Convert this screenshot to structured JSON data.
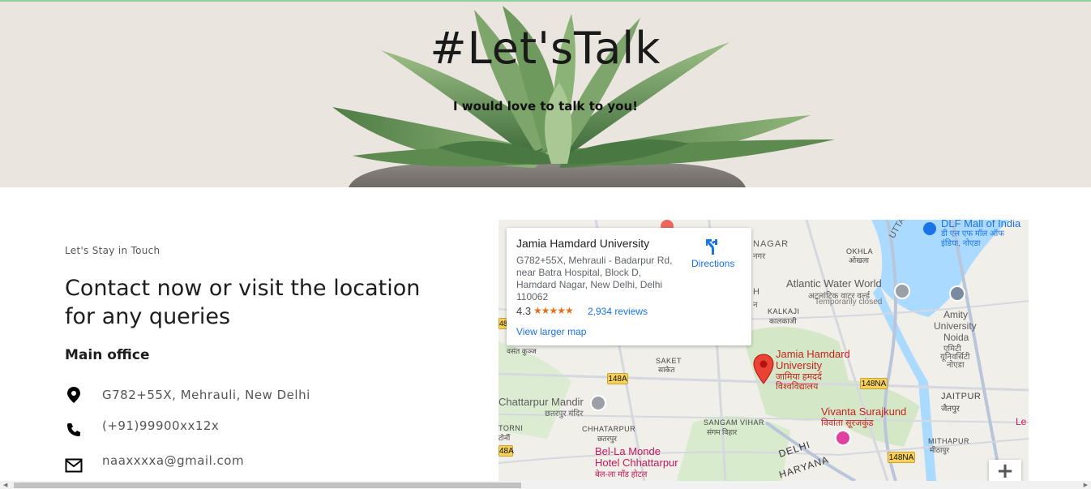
{
  "hero": {
    "title": "#Let'sTalk",
    "subtitle": "I would love to talk to you!"
  },
  "contact": {
    "eyebrow": "Let's Stay in Touch",
    "heading": "Contact now or visit the location for any queries",
    "office_label": "Main office",
    "address": "G782+55X, Mehrauli, New Delhi",
    "phone": "(+91)99900xx12x",
    "email": "naaxxxxa@gmail.com",
    "icons": [
      "location-pin-icon",
      "phone-icon",
      "mail-icon"
    ]
  },
  "map": {
    "card": {
      "name": "Jamia Hamdard University",
      "address": "G782+55X, Mehrauli - Badarpur Rd, near Batra Hospital, Block D, Hamdard Nagar, New Delhi, Delhi 110062",
      "rating": "4.3",
      "stars": "★★★★★",
      "reviews": "2,934 reviews",
      "view_larger": "View larger map",
      "directions": "Directions"
    },
    "labels": {
      "nagar": "NAGAR",
      "nagar_hi": "नगर",
      "okhla": "OKHLA",
      "okhla_hi": "ओखला",
      "dlf": "DLF Mall of India",
      "dlf_hi_1": "डी एल एफ मॉल ऑफ",
      "dlf_hi_2": "इंडिया, नोएडा",
      "atlantic": "Atlantic Water World",
      "atlantic_hi": "अटलांटिक वाटर वर्ल्ड",
      "atlantic_status": "Temporarily closed",
      "kalkaji": "KALKAJI",
      "kalkaji_hi": "कालकाजी",
      "amity_1": "Amity",
      "amity_2": "University",
      "amity_3": "Noida",
      "amity_hi_1": "एमिटी",
      "amity_hi_2": "यूनिवर्सिटी",
      "amity_hi_3": "नोएडा",
      "jamia_1": "Jamia Hamdard",
      "jamia_2": "University",
      "jamia_hi_1": "जामिया हमदर्द",
      "jamia_hi_2": "विश्वविद्यालय",
      "saket": "SAKET",
      "saket_hi": "साकेत",
      "vasant": "वसंत कुञ्ज",
      "road_148a_1": "148A",
      "road_148na_1": "148NA",
      "road_148na_2": "148NA",
      "road_148a_2": "48A",
      "road_48a_left": "48A",
      "chattarpur_mandir": "Chattarpur Mandir",
      "chattarpur_mandir_hi": "छतरपुर मंदिर",
      "chhatarpur": "CHHATARPUR",
      "chhatarpur_hi": "छतरपुर",
      "torni": "TORNI",
      "torni_hi": "टोर्नी",
      "sangam": "SANGAM VIHAR",
      "sangam_hi": "संगम विहार",
      "jaitpur": "JAITPUR",
      "jaitpur_hi": "जैतपुर",
      "vivanta": "Vivanta Surajkund",
      "vivanta_hi": "विवांता सूरजकुंड",
      "belamonde_1": "Bel-La Monde",
      "belamonde_2": "Hotel Chhattarpur",
      "belamonde_hi": "बेल-ला मॉंड होटल",
      "mithapur": "MITHAPUR",
      "mithapur_hi": "मीठापुर",
      "delhi": "DELHI",
      "haryana": "HARYANA",
      "utta": "UTTA",
      "le": "Le",
      "h_frag": "H",
      "h_hi": "न"
    },
    "zoom_in": "+"
  }
}
